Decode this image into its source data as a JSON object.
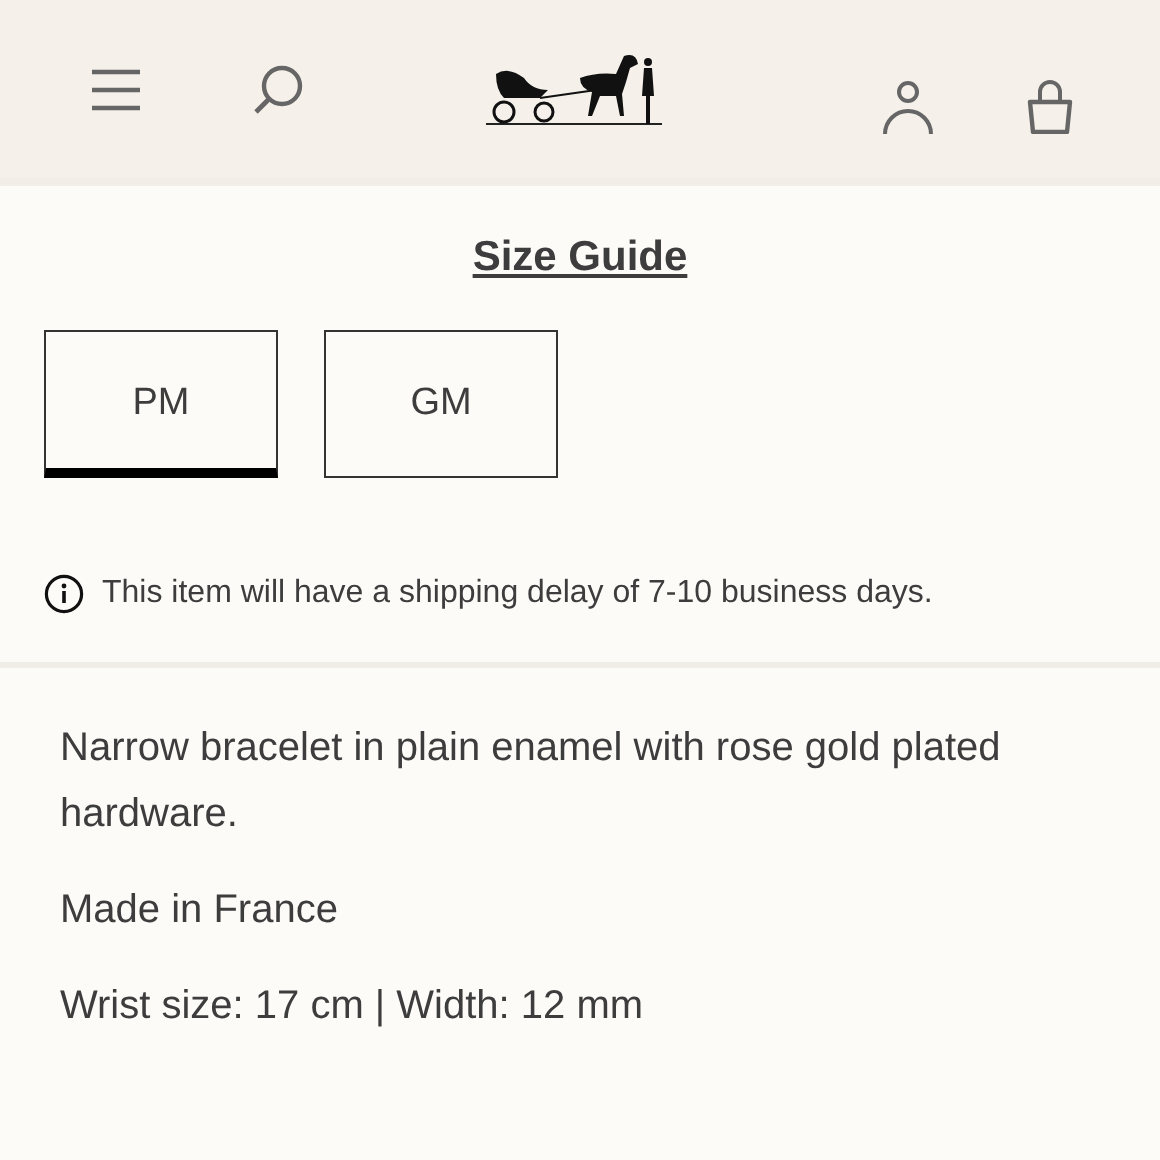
{
  "size_guide": "Size Guide",
  "sizes": [
    {
      "label": "PM",
      "selected": true
    },
    {
      "label": "GM",
      "selected": false
    }
  ],
  "notice": "This item will have a shipping delay of 7-10 business days.",
  "description": [
    "Narrow bracelet in plain enamel with rose gold plated hardware.",
    "Made in France",
    "Wrist size: 17 cm | Width: 12 mm"
  ]
}
